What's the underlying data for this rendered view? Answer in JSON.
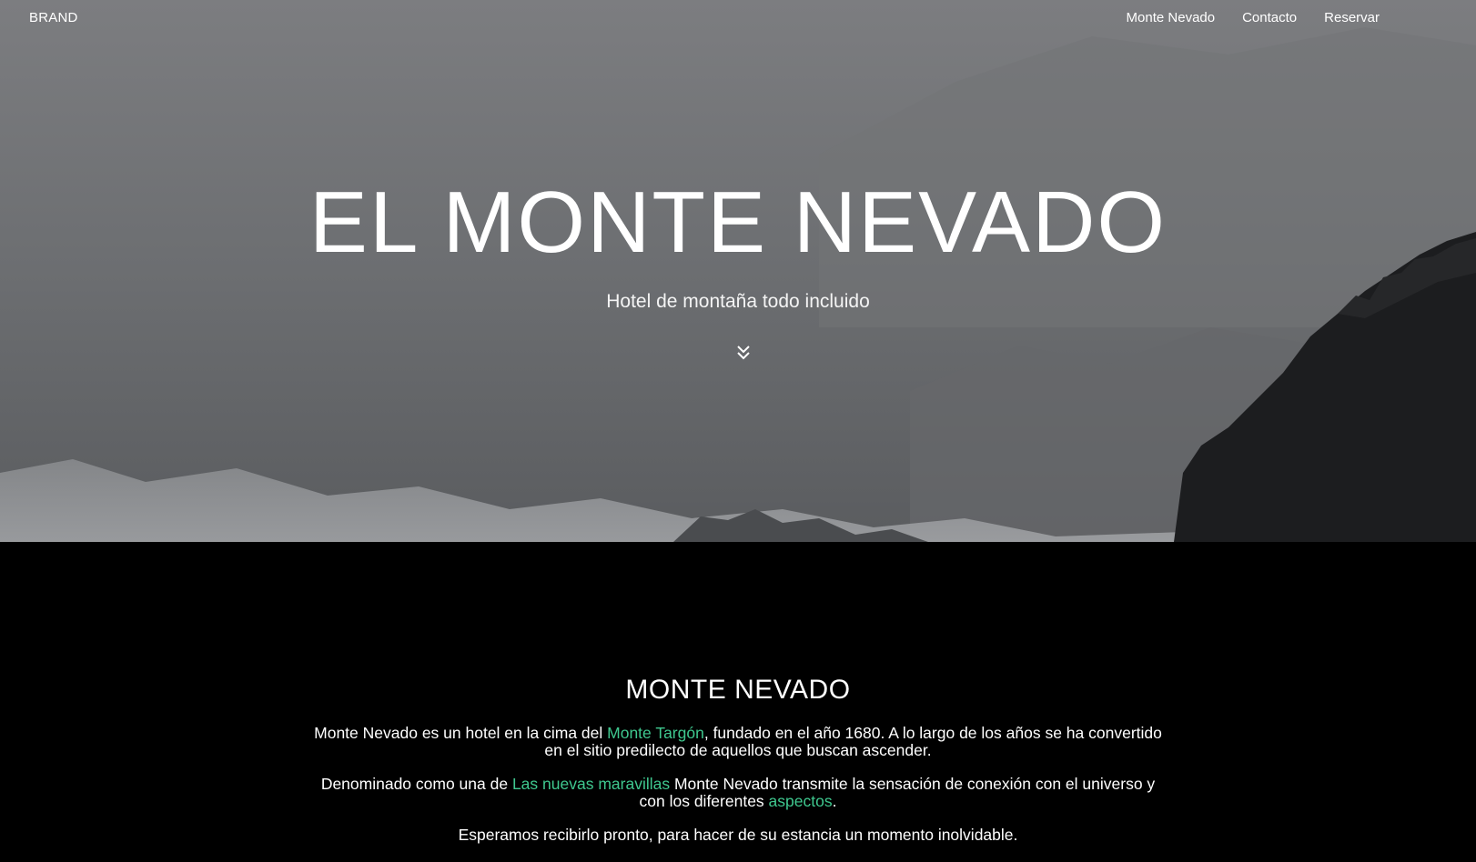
{
  "nav": {
    "brand": "BRAND",
    "links": [
      "Monte Nevado",
      "Contacto",
      "Reservar"
    ]
  },
  "hero": {
    "title": "EL MONTE NEVADO",
    "subtitle": "Hotel de montaña todo incluido",
    "scroll_icon": "double-chevron-down-icon"
  },
  "about": {
    "heading": "MONTE NEVADO",
    "p1": {
      "t1": "Monte Nevado es un hotel en la cima del ",
      "link": "Monte Targón",
      "t2": ", fundado en el año 1680. A lo largo de los años se ha convertido en el sitio predilecto de aquellos que buscan ascender."
    },
    "p2": {
      "t1": "Denominado como una de ",
      "link1": "Las nuevas maravillas",
      "t2": " Monte Nevado transmite la sensación de conexión con el universo y con los diferentes ",
      "link2": "aspectos",
      "t3": "."
    },
    "p3": "Esperamos recibirlo pronto, para hacer de su estancia un momento inolvidable."
  },
  "colors": {
    "link_accent": "#3fc88f",
    "background": "#000000"
  }
}
